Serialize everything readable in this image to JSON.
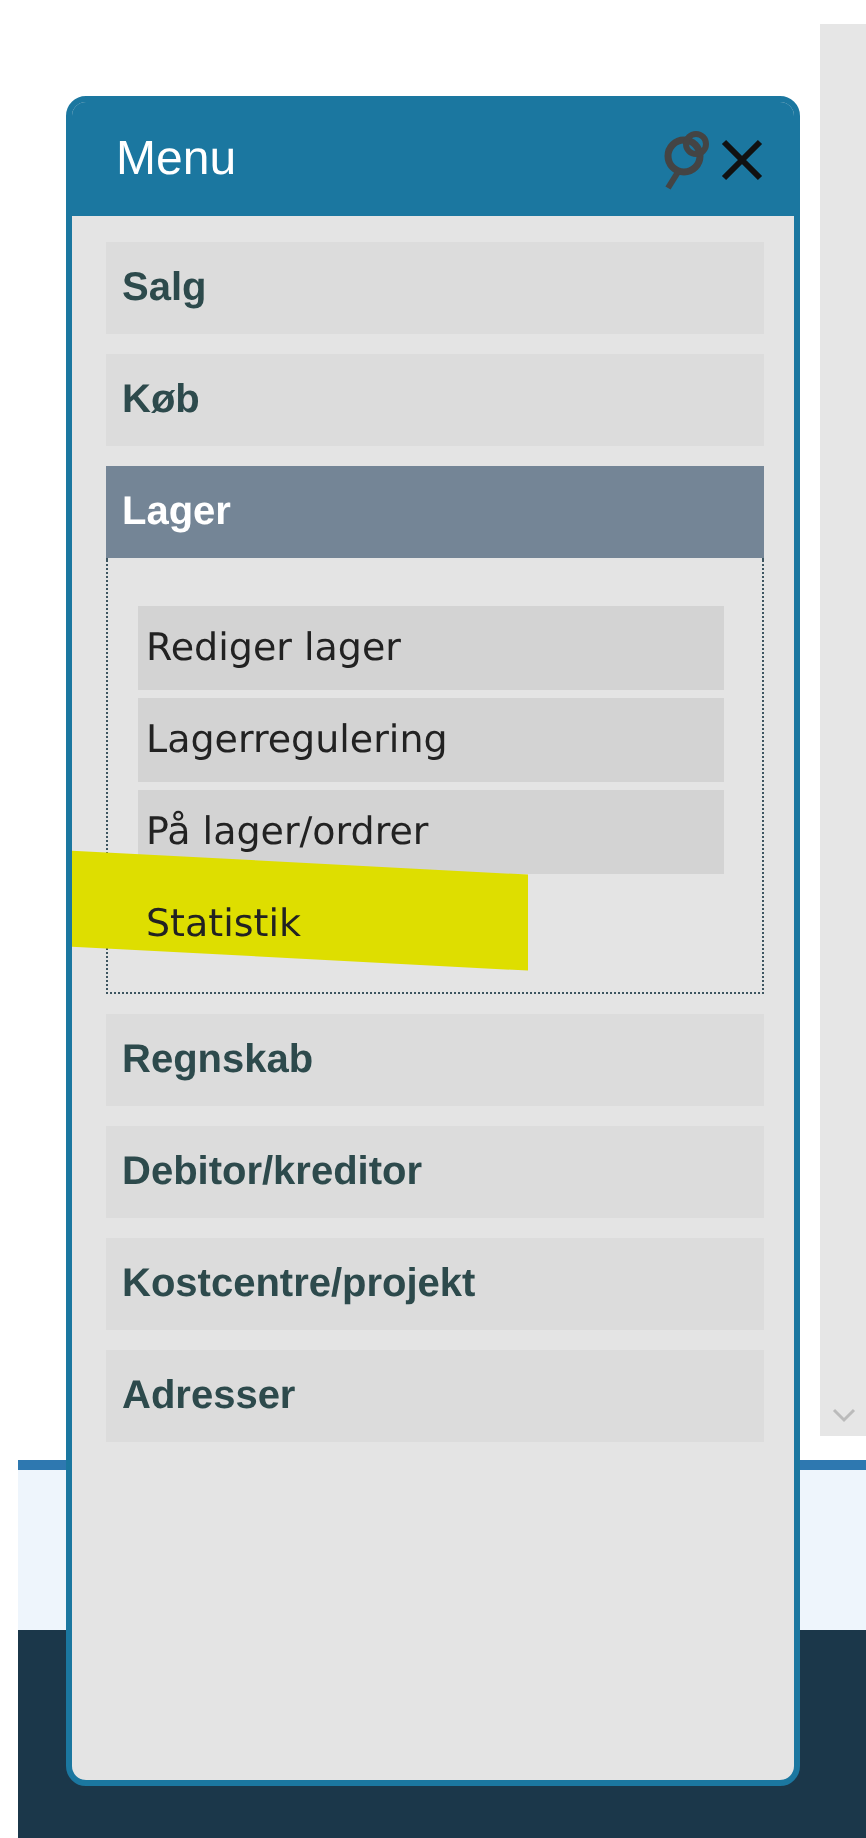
{
  "menu": {
    "title": "Menu",
    "items": [
      {
        "label": "Salg",
        "selected": false
      },
      {
        "label": "Køb",
        "selected": false
      },
      {
        "label": "Lager",
        "selected": true,
        "expanded": true,
        "children": [
          {
            "label": "Rediger lager",
            "highlighted": false
          },
          {
            "label": "Lagerregulering",
            "highlighted": false
          },
          {
            "label": "På lager/ordrer",
            "highlighted": false
          },
          {
            "label": "Statistik",
            "highlighted": true
          }
        ]
      },
      {
        "label": "Regnskab",
        "selected": false
      },
      {
        "label": "Debitor/kreditor",
        "selected": false
      },
      {
        "label": "Kostcentre/projekt",
        "selected": false
      },
      {
        "label": "Adresser",
        "selected": false
      }
    ]
  }
}
